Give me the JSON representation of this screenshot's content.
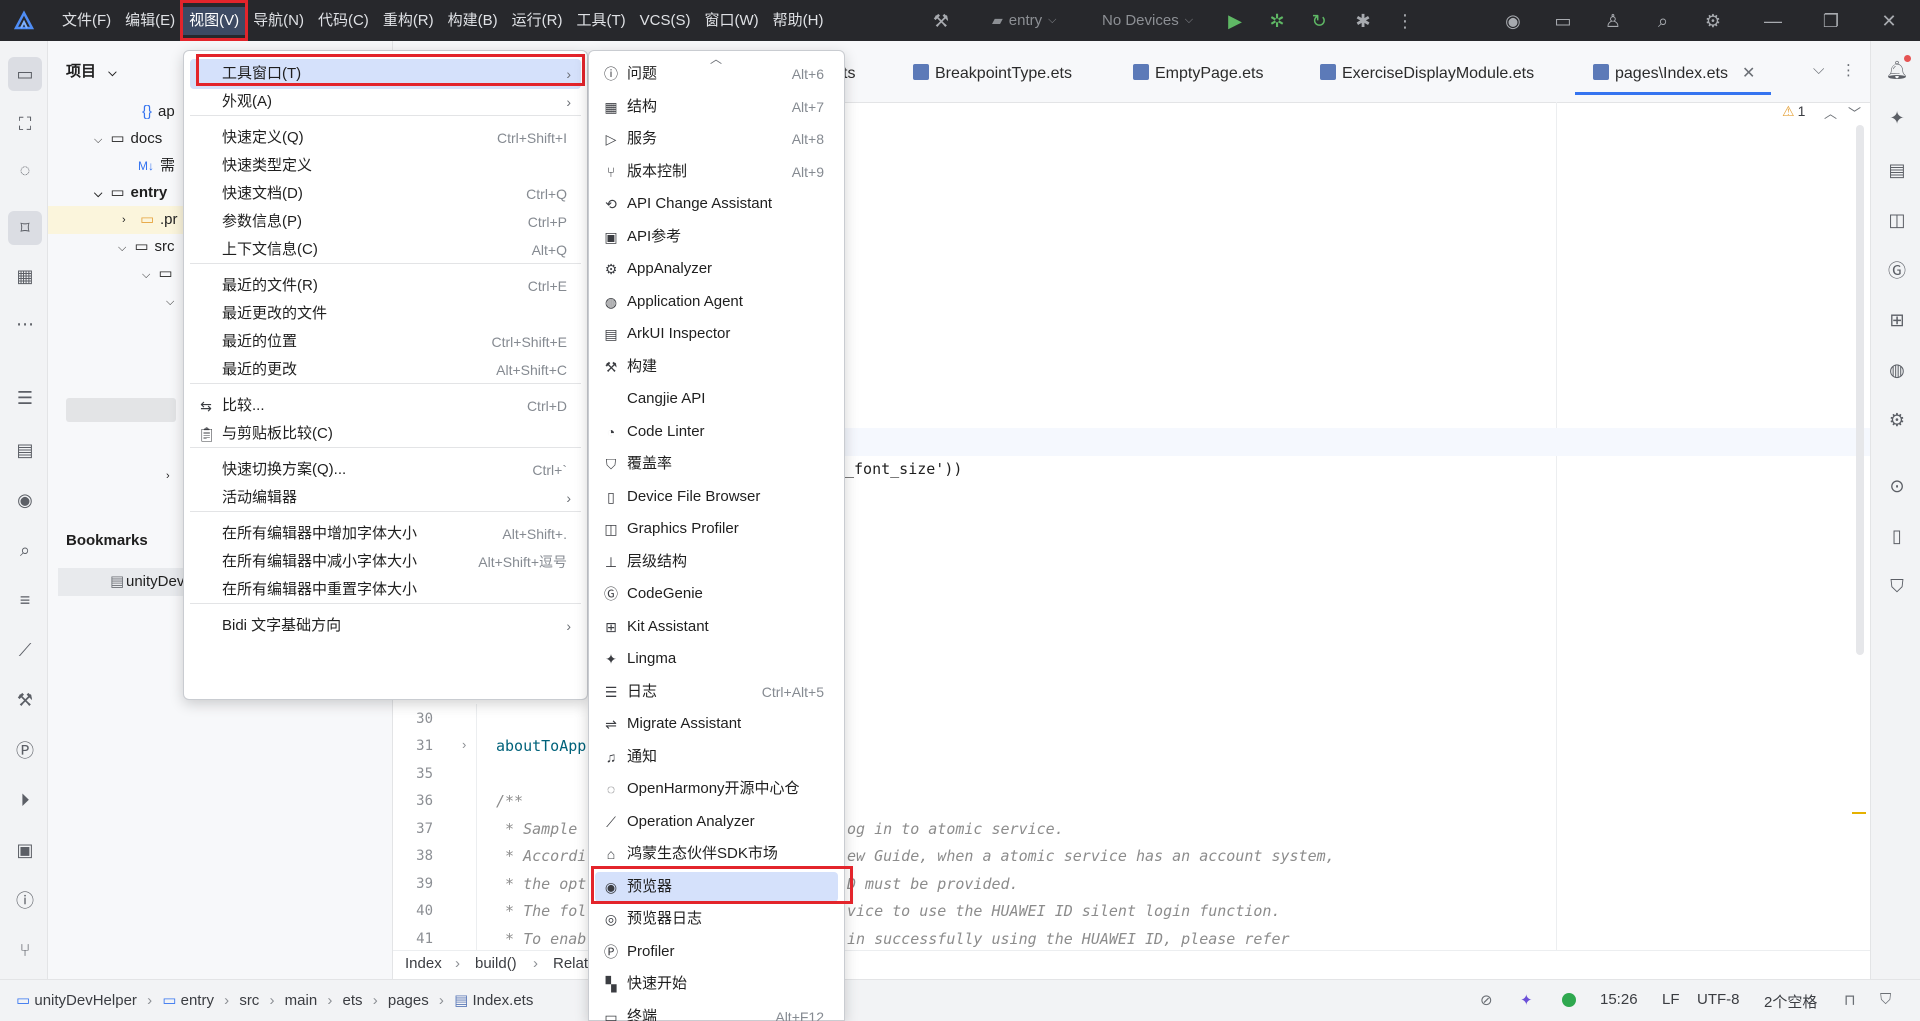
{
  "titlebar": {
    "menu": [
      "文件(F)",
      "编辑(E)",
      "视图(V)",
      "导航(N)",
      "代码(C)",
      "重构(R)",
      "构建(B)",
      "运行(R)",
      "工具(T)",
      "VCS(S)",
      "窗口(W)",
      "帮助(H)"
    ],
    "run_config": "entry",
    "device": "No Devices"
  },
  "project": {
    "header": "项目",
    "rows": [
      {
        "label": "ap",
        "indent": 0
      },
      {
        "label": "docs",
        "indent": 1
      },
      {
        "label": "需",
        "indent": 2
      },
      {
        "label": "entry",
        "indent": 1
      },
      {
        "label": ".pr",
        "indent": 2
      },
      {
        "label": "src",
        "indent": 2
      }
    ],
    "bookmarks_header": "Bookmarks",
    "bookmark_item": "unityDevH"
  },
  "tabs": {
    "items": [
      "ts",
      "BreakpointType.ets",
      "EmptyPage.ets",
      "ExerciseDisplayModule.ets",
      "pages\\Index.ets"
    ],
    "warning_count": "1"
  },
  "editor": {
    "line_numbers": [
      "30",
      "31",
      "35",
      "36",
      "37",
      "38",
      "39",
      "40",
      "41"
    ],
    "code_font_size": "_font_size'))",
    "code_about": "aboutToApp",
    "comment_lines": [
      "/**",
      " * Sample",
      " * Accordi",
      " * the opt",
      " * The fol",
      " * To enab"
    ],
    "comment_tails": [
      "og in to atomic service.",
      "ew Guide, when a atomic service has an account system,",
      "D must be provided.",
      "vice to use the HUAWEI ID silent login function.",
      "in successfully using the HUAWEI ID, please refer"
    ],
    "breadcrumb": [
      "Index",
      "build()",
      "Relat"
    ]
  },
  "view_menu": {
    "items": [
      {
        "label": "工具窗口(T)",
        "shortcut": "",
        "submenu": true,
        "highlight": true
      },
      {
        "label": "外观(A)",
        "shortcut": "",
        "submenu": true
      },
      {
        "label": "快速定义(Q)",
        "shortcut": "Ctrl+Shift+I"
      },
      {
        "label": "快速类型定义",
        "shortcut": ""
      },
      {
        "label": "快速文档(D)",
        "shortcut": "Ctrl+Q"
      },
      {
        "label": "参数信息(P)",
        "shortcut": "Ctrl+P"
      },
      {
        "label": "上下文信息(C)",
        "shortcut": "Alt+Q"
      },
      {
        "label": "最近的文件(R)",
        "shortcut": "Ctrl+E"
      },
      {
        "label": "最近更改的文件",
        "shortcut": ""
      },
      {
        "label": "最近的位置",
        "shortcut": "Ctrl+Shift+E"
      },
      {
        "label": "最近的更改",
        "shortcut": "Alt+Shift+C"
      },
      {
        "label": "比较...",
        "shortcut": "Ctrl+D"
      },
      {
        "label": "与剪贴板比较(C)",
        "shortcut": ""
      },
      {
        "label": "快速切换方案(Q)...",
        "shortcut": "Ctrl+`"
      },
      {
        "label": "活动编辑器",
        "shortcut": "",
        "submenu": true
      },
      {
        "label": "在所有编辑器中增加字体大小",
        "shortcut": "Alt+Shift+."
      },
      {
        "label": "在所有编辑器中减小字体大小",
        "shortcut": "Alt+Shift+逗号"
      },
      {
        "label": "在所有编辑器中重置字体大小",
        "shortcut": ""
      },
      {
        "label": "Bidi 文字基础方向",
        "shortcut": "",
        "submenu": true
      }
    ]
  },
  "tool_windows_menu": {
    "items": [
      {
        "label": "问题",
        "shortcut": "Alt+6",
        "icon": "problems-icon"
      },
      {
        "label": "结构",
        "shortcut": "Alt+7",
        "icon": "structure-icon"
      },
      {
        "label": "服务",
        "shortcut": "Alt+8",
        "icon": "services-icon"
      },
      {
        "label": "版本控制",
        "shortcut": "Alt+9",
        "icon": "vcs-icon"
      },
      {
        "label": "API Change Assistant",
        "shortcut": "",
        "icon": "api-change-icon"
      },
      {
        "label": "API参考",
        "shortcut": "",
        "icon": "api-reference-icon"
      },
      {
        "label": "AppAnalyzer",
        "shortcut": "",
        "icon": "app-analyzer-icon"
      },
      {
        "label": "Application Agent",
        "shortcut": "",
        "icon": "application-agent-icon"
      },
      {
        "label": "ArkUI Inspector",
        "shortcut": "",
        "icon": "arkui-inspector-icon"
      },
      {
        "label": "构建",
        "shortcut": "",
        "icon": "build-icon"
      },
      {
        "label": "Cangjie API",
        "shortcut": "",
        "icon": ""
      },
      {
        "label": "Code Linter",
        "shortcut": "",
        "icon": "code-linter-icon"
      },
      {
        "label": "覆盖率",
        "shortcut": "",
        "icon": "coverage-icon"
      },
      {
        "label": "Device File Browser",
        "shortcut": "",
        "icon": "device-file-icon"
      },
      {
        "label": "Graphics Profiler",
        "shortcut": "",
        "icon": "graphics-profiler-icon"
      },
      {
        "label": "层级结构",
        "shortcut": "",
        "icon": "hierarchy-icon"
      },
      {
        "label": "CodeGenie",
        "shortcut": "",
        "icon": "codegenie-icon"
      },
      {
        "label": "Kit Assistant",
        "shortcut": "",
        "icon": "kit-assistant-icon"
      },
      {
        "label": "Lingma",
        "shortcut": "",
        "icon": "lingma-icon"
      },
      {
        "label": "日志",
        "shortcut": "Ctrl+Alt+5",
        "icon": "log-icon"
      },
      {
        "label": "Migrate Assistant",
        "shortcut": "",
        "icon": "migrate-icon"
      },
      {
        "label": "通知",
        "shortcut": "",
        "icon": "notification-icon"
      },
      {
        "label": "OpenHarmony开源中心仓",
        "shortcut": "",
        "icon": "openharmony-icon"
      },
      {
        "label": "Operation Analyzer",
        "shortcut": "",
        "icon": "operation-analyzer-icon"
      },
      {
        "label": "鸿蒙生态伙伴SDK市场",
        "shortcut": "",
        "icon": "sdk-market-icon"
      },
      {
        "label": "预览器",
        "shortcut": "",
        "icon": "previewer-icon",
        "highlight": true
      },
      {
        "label": "预览器日志",
        "shortcut": "",
        "icon": "previewer-log-icon"
      },
      {
        "label": "Profiler",
        "shortcut": "",
        "icon": "profiler-icon"
      },
      {
        "label": "快速开始",
        "shortcut": "",
        "icon": "quick-start-icon"
      },
      {
        "label": "终端",
        "shortcut": "Alt+F12",
        "icon": "terminal-icon"
      }
    ]
  },
  "statusbar": {
    "breadcrumb": [
      "unityDevHelper",
      "entry",
      "src",
      "main",
      "ets",
      "pages",
      "Index.ets"
    ],
    "time": "15:26",
    "line_sep": "LF",
    "encoding": "UTF-8",
    "indent": "2个空格"
  },
  "colors": {
    "highlight": "#d5e1fb",
    "red_annotation": "#e3242b",
    "titlebar": "#27282c"
  }
}
